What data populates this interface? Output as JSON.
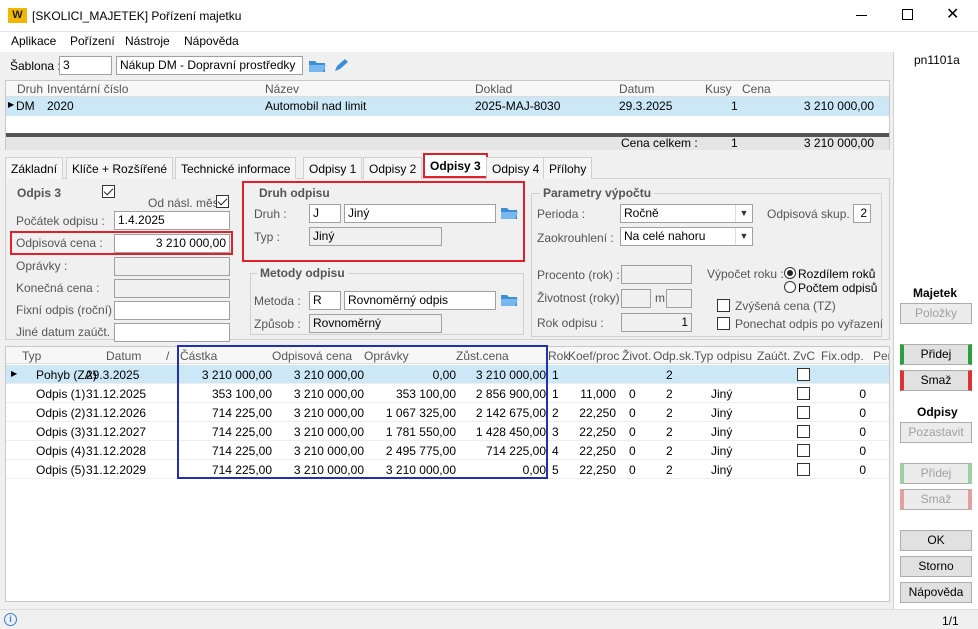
{
  "window": {
    "title": "[SKOLICI_MAJETEK] Pořízení majetku",
    "logo": "W"
  },
  "menu": [
    "Aplikace",
    "Pořízení",
    "Nástroje",
    "Nápověda"
  ],
  "form_code": "pn1101a",
  "sablona": {
    "label": "Šablona :",
    "code": "3",
    "name": "Nákup DM - Dopravní prostředky"
  },
  "top_grid": {
    "headers": [
      "Druh",
      "Inventární číslo",
      "Název",
      "Doklad",
      "Datum",
      "Kusy",
      "Cena"
    ],
    "row": {
      "druh": "DM",
      "inv": "2020",
      "nazev": "Automobil nad limit",
      "doklad": "2025-MAJ-8030",
      "datum": "29.3.2025",
      "kusy": "1",
      "cena": "3 210 000,00"
    },
    "total": {
      "label": "Cena celkem :",
      "kusy": "1",
      "cena": "3 210 000,00"
    }
  },
  "tabs": [
    "Základní",
    "Klíče + Rozšířené",
    "Technické informace",
    "Odpisy 1",
    "Odpisy 2",
    "Odpisy 3",
    "Odpisy 4",
    "Přílohy"
  ],
  "odpis": {
    "title": "Odpis 3",
    "od_nasl_label": "Od násl. měs.",
    "pocatek_label": "Počátek odpisu :",
    "pocatek": "1.4.2025",
    "cena_label": "Odpisová cena :",
    "cena": "3 210 000,00",
    "opravky_label": "Oprávky :",
    "konecna_label": "Konečná cena :",
    "fixni_label": "Fixní odpis (roční) :",
    "jine_label": "Jiné datum zaúčt. :"
  },
  "druh_odpisu": {
    "title": "Druh odpisu",
    "druh_label": "Druh :",
    "druh_code": "J",
    "druh_name": "Jiný",
    "typ_label": "Typ :",
    "typ": "Jiný"
  },
  "metody": {
    "title": "Metody odpisu",
    "metoda_label": "Metoda :",
    "metoda_code": "R",
    "metoda_name": "Rovnoměrný odpis",
    "zpusob_label": "Způsob :",
    "zpusob": "Rovnoměrný"
  },
  "parametry": {
    "title": "Parametry výpočtu",
    "perioda_label": "Perioda :",
    "perioda": "Ročně",
    "skup_label": "Odpisová skup. :",
    "skup": "2",
    "zaokr_label": "Zaokrouhlení :",
    "zaokr": "Na celé nahoru",
    "procento_label": "Procento (rok) :",
    "zivotnost_label": "Životnost (roky)",
    "m_label": "m",
    "rok_label": "Rok odpisu :",
    "rok": "1",
    "vypocet_label": "Výpočet roku :",
    "radio1": "Rozdílem roků",
    "radio2": "Počtem odpisů",
    "zvysena": "Zvýšená cena (TZ)",
    "ponechat": "Ponechat odpis po vyřazení"
  },
  "grid": {
    "headers": [
      "Typ",
      "Datum",
      "Částka",
      "Odpisová cena",
      "Oprávky",
      "Zůst.cena",
      "Rok",
      "Koef/proc",
      "Život.",
      "Odp.sk.",
      "Typ odpisu",
      "Zaúčt.",
      "ZvC",
      "Fix.odp.",
      "Per"
    ],
    "rows": [
      {
        "typ": "Pohyb (ZA)",
        "datum": "29.3.2025",
        "castka": "3 210 000,00",
        "cena": "3 210 000,00",
        "opravky": "0,00",
        "zust": "3 210 000,00",
        "rok": "1",
        "koef": "",
        "ziv": "",
        "sk": "2",
        "typo": "",
        "fix": ""
      },
      {
        "typ": "Odpis (1)",
        "datum": "31.12.2025",
        "castka": "353 100,00",
        "cena": "3 210 000,00",
        "opravky": "353 100,00",
        "zust": "2 856 900,00",
        "rok": "1",
        "koef": "11,000",
        "ziv": "0",
        "sk": "2",
        "typo": "Jiný",
        "fix": "0"
      },
      {
        "typ": "Odpis (2)",
        "datum": "31.12.2026",
        "castka": "714 225,00",
        "cena": "3 210 000,00",
        "opravky": "1 067 325,00",
        "zust": "2 142 675,00",
        "rok": "2",
        "koef": "22,250",
        "ziv": "0",
        "sk": "2",
        "typo": "Jiný",
        "fix": "0"
      },
      {
        "typ": "Odpis (3)",
        "datum": "31.12.2027",
        "castka": "714 225,00",
        "cena": "3 210 000,00",
        "opravky": "1 781 550,00",
        "zust": "1 428 450,00",
        "rok": "3",
        "koef": "22,250",
        "ziv": "0",
        "sk": "2",
        "typo": "Jiný",
        "fix": "0"
      },
      {
        "typ": "Odpis (4)",
        "datum": "31.12.2028",
        "castka": "714 225,00",
        "cena": "3 210 000,00",
        "opravky": "2 495 775,00",
        "zust": "714 225,00",
        "rok": "4",
        "koef": "22,250",
        "ziv": "0",
        "sk": "2",
        "typo": "Jiný",
        "fix": "0"
      },
      {
        "typ": "Odpis (5)",
        "datum": "31.12.2029",
        "castka": "714 225,00",
        "cena": "3 210 000,00",
        "opravky": "3 210 000,00",
        "zust": "0,00",
        "rok": "5",
        "koef": "22,250",
        "ziv": "0",
        "sk": "2",
        "typo": "Jiný",
        "fix": "0"
      }
    ]
  },
  "side": {
    "majetek": "Majetek",
    "polozky": "Položky",
    "pridej": "Přidej",
    "smaz": "Smaž",
    "odpisy": "Odpisy",
    "pozastavit": "Pozastavit",
    "pridej2": "Přidej",
    "smaz2": "Smaž",
    "ok": "OK",
    "storno": "Storno",
    "napoveda": "Nápověda"
  },
  "status": {
    "page": "1/1"
  },
  "colors": {
    "selected": "#cce8f7",
    "highlight": "#e0202a",
    "blue_box": "#2030b0"
  }
}
